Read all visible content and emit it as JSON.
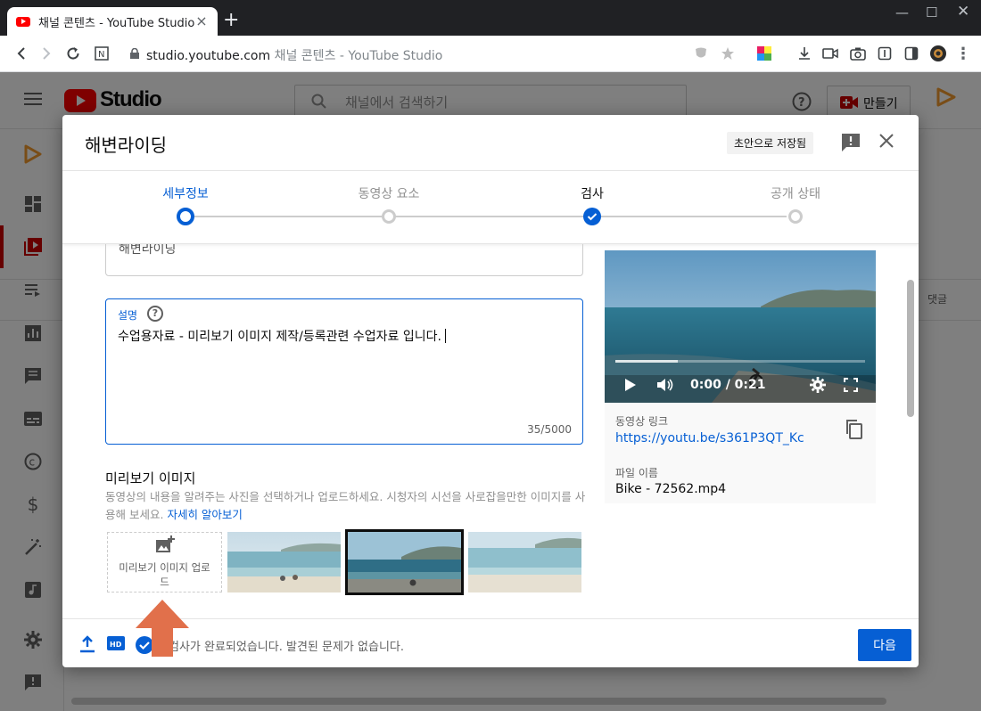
{
  "browser": {
    "tab_title": "채널 콘텐츠 - YouTube Studio",
    "url_host": "studio.youtube.com",
    "url_separator": "채널 콘텐츠 - YouTube Studio"
  },
  "studio": {
    "logo_text": "Studio",
    "search_placeholder": "채널에서 검색하기",
    "create_button": "만들기",
    "col_comments": "댓글"
  },
  "modal": {
    "title": "해변라이딩",
    "draft_badge": "초안으로 저장됨",
    "steps": [
      {
        "label": "세부정보",
        "state": "active"
      },
      {
        "label": "동영상 요소",
        "state": "pending"
      },
      {
        "label": "검사",
        "state": "done"
      },
      {
        "label": "공개 상태",
        "state": "pending"
      }
    ],
    "title_field_partial": "해변라이딩",
    "description": {
      "label": "설명",
      "value": "수업용자료 - 미리보기 이미지 제작/등록관련 수업자료 입니다.",
      "count": "35/5000"
    },
    "thumbnail": {
      "title": "미리보기 이미지",
      "desc": "동영상의 내용을 알려주는 사진을 선택하거나 업로드하세요. 시청자의 시선을 사로잡을만한 이미지를 사용해 보세요.",
      "learn_more": "자세히 알아보기",
      "upload_label": "미리보기 이미지 업로드"
    },
    "preview": {
      "time": "0:00 / 0:21",
      "video_link_label": "동영상 링크",
      "video_link": "https://youtu.be/s361P3QT_Kc",
      "file_name_label": "파일 이름",
      "file_name": "Bike - 72562.mp4"
    },
    "footer": {
      "status": "검사가 완료되었습니다. 발견된 문제가 없습니다.",
      "next": "다음",
      "hd_badge": "HD"
    }
  },
  "colors": {
    "accent": "#065fd4",
    "yt_red": "#ff0000",
    "arrow": "#e1704b"
  }
}
